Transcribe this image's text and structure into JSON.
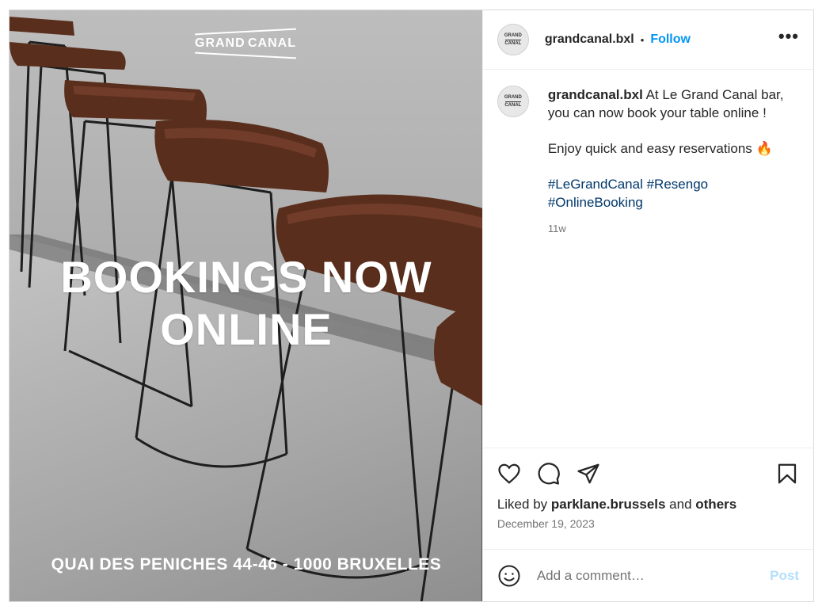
{
  "colors": {
    "accent": "#0095f6",
    "hashtag": "#00376b",
    "post_disabled": "#b3dffc",
    "muted": "#737373"
  },
  "media": {
    "logo": {
      "word1": "GRAND",
      "word2": "CANAL"
    },
    "headline_line1": "BOOKINGS NOW",
    "headline_line2": "ONLINE",
    "address": "QUAI DES PENICHES 44-46 - 1000 BRUXELLES"
  },
  "header": {
    "avatar_text_1": "GRAND",
    "avatar_text_2": "CANAL",
    "username": "grandcanal.bxl",
    "separator": "•",
    "follow_label": "Follow",
    "more_icon": "more-horizontal-icon",
    "more_glyph": "•••"
  },
  "caption": {
    "username": "grandcanal.bxl",
    "line1": " At Le Grand Canal bar, you can now book your table online !",
    "line2": "Enjoy quick and easy reservations 🔥",
    "hashtags": [
      "#LeGrandCanal",
      "#Resengo",
      "#OnlineBooking"
    ],
    "time": "11w"
  },
  "actions": {
    "icons": [
      "heart-icon",
      "comment-icon",
      "share-icon",
      "bookmark-icon"
    ],
    "liked_by_prefix": "Liked by ",
    "liked_by_user": "parklane.brussels",
    "liked_by_middle": " and ",
    "liked_by_others": "others",
    "date": "December 19, 2023"
  },
  "comment": {
    "emoji_icon": "smiley-icon",
    "placeholder": "Add a comment…",
    "post_label": "Post"
  }
}
